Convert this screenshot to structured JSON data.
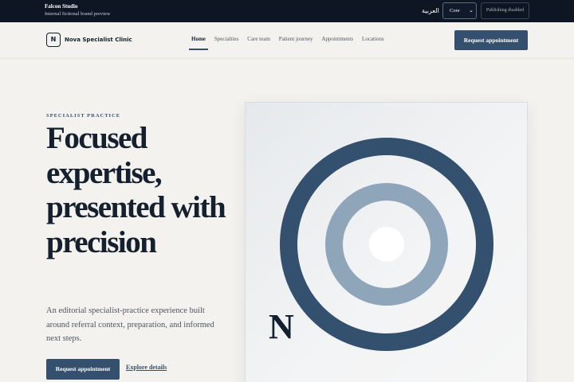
{
  "studio": {
    "name": "Falcon Studio",
    "subtitle": "Internal fictional brand preview",
    "language_label": "العربية",
    "theme_selected": "Core",
    "publish_label": "Publishing disabled"
  },
  "nav": {
    "brand_initial": "N",
    "brand_name": "Nova Specialist Clinic",
    "links": [
      {
        "label": "Home",
        "active": true
      },
      {
        "label": "Specialties",
        "active": false
      },
      {
        "label": "Care team",
        "active": false
      },
      {
        "label": "Patient journey",
        "active": false
      },
      {
        "label": "Appointments",
        "active": false
      },
      {
        "label": "Locations",
        "active": false
      }
    ],
    "cta_label": "Request appointment"
  },
  "hero": {
    "eyebrow": "SPECIALIST PRACTICE",
    "headline": "Focused expertise, presented with precision",
    "lede": "An editorial specialist-practice experience built around referral context, preparation, and informed next steps.",
    "primary_label": "Request appointment",
    "secondary_label": "Explore details",
    "visual_initial": "N"
  },
  "colors": {
    "navy": "#35506e",
    "ring_outer": "#34506f",
    "ring_inner": "#8ea5ba",
    "ink": "#14202e",
    "background": "#f4f2ee"
  }
}
